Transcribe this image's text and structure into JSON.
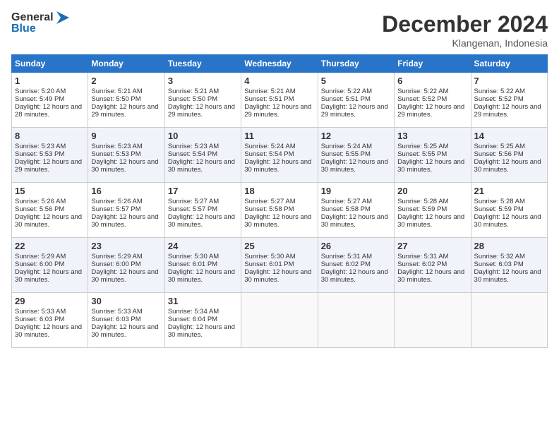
{
  "header": {
    "logo_general": "General",
    "logo_blue": "Blue",
    "month_title": "December 2024",
    "subtitle": "Klangenan, Indonesia"
  },
  "days_of_week": [
    "Sunday",
    "Monday",
    "Tuesday",
    "Wednesday",
    "Thursday",
    "Friday",
    "Saturday"
  ],
  "weeks": [
    [
      {
        "day": "1",
        "sunrise": "Sunrise: 5:20 AM",
        "sunset": "Sunset: 5:49 PM",
        "daylight": "Daylight: 12 hours and 28 minutes."
      },
      {
        "day": "2",
        "sunrise": "Sunrise: 5:21 AM",
        "sunset": "Sunset: 5:50 PM",
        "daylight": "Daylight: 12 hours and 29 minutes."
      },
      {
        "day": "3",
        "sunrise": "Sunrise: 5:21 AM",
        "sunset": "Sunset: 5:50 PM",
        "daylight": "Daylight: 12 hours and 29 minutes."
      },
      {
        "day": "4",
        "sunrise": "Sunrise: 5:21 AM",
        "sunset": "Sunset: 5:51 PM",
        "daylight": "Daylight: 12 hours and 29 minutes."
      },
      {
        "day": "5",
        "sunrise": "Sunrise: 5:22 AM",
        "sunset": "Sunset: 5:51 PM",
        "daylight": "Daylight: 12 hours and 29 minutes."
      },
      {
        "day": "6",
        "sunrise": "Sunrise: 5:22 AM",
        "sunset": "Sunset: 5:52 PM",
        "daylight": "Daylight: 12 hours and 29 minutes."
      },
      {
        "day": "7",
        "sunrise": "Sunrise: 5:22 AM",
        "sunset": "Sunset: 5:52 PM",
        "daylight": "Daylight: 12 hours and 29 minutes."
      }
    ],
    [
      {
        "day": "8",
        "sunrise": "Sunrise: 5:23 AM",
        "sunset": "Sunset: 5:53 PM",
        "daylight": "Daylight: 12 hours and 29 minutes."
      },
      {
        "day": "9",
        "sunrise": "Sunrise: 5:23 AM",
        "sunset": "Sunset: 5:53 PM",
        "daylight": "Daylight: 12 hours and 30 minutes."
      },
      {
        "day": "10",
        "sunrise": "Sunrise: 5:23 AM",
        "sunset": "Sunset: 5:54 PM",
        "daylight": "Daylight: 12 hours and 30 minutes."
      },
      {
        "day": "11",
        "sunrise": "Sunrise: 5:24 AM",
        "sunset": "Sunset: 5:54 PM",
        "daylight": "Daylight: 12 hours and 30 minutes."
      },
      {
        "day": "12",
        "sunrise": "Sunrise: 5:24 AM",
        "sunset": "Sunset: 5:55 PM",
        "daylight": "Daylight: 12 hours and 30 minutes."
      },
      {
        "day": "13",
        "sunrise": "Sunrise: 5:25 AM",
        "sunset": "Sunset: 5:55 PM",
        "daylight": "Daylight: 12 hours and 30 minutes."
      },
      {
        "day": "14",
        "sunrise": "Sunrise: 5:25 AM",
        "sunset": "Sunset: 5:56 PM",
        "daylight": "Daylight: 12 hours and 30 minutes."
      }
    ],
    [
      {
        "day": "15",
        "sunrise": "Sunrise: 5:26 AM",
        "sunset": "Sunset: 5:56 PM",
        "daylight": "Daylight: 12 hours and 30 minutes."
      },
      {
        "day": "16",
        "sunrise": "Sunrise: 5:26 AM",
        "sunset": "Sunset: 5:57 PM",
        "daylight": "Daylight: 12 hours and 30 minutes."
      },
      {
        "day": "17",
        "sunrise": "Sunrise: 5:27 AM",
        "sunset": "Sunset: 5:57 PM",
        "daylight": "Daylight: 12 hours and 30 minutes."
      },
      {
        "day": "18",
        "sunrise": "Sunrise: 5:27 AM",
        "sunset": "Sunset: 5:58 PM",
        "daylight": "Daylight: 12 hours and 30 minutes."
      },
      {
        "day": "19",
        "sunrise": "Sunrise: 5:27 AM",
        "sunset": "Sunset: 5:58 PM",
        "daylight": "Daylight: 12 hours and 30 minutes."
      },
      {
        "day": "20",
        "sunrise": "Sunrise: 5:28 AM",
        "sunset": "Sunset: 5:59 PM",
        "daylight": "Daylight: 12 hours and 30 minutes."
      },
      {
        "day": "21",
        "sunrise": "Sunrise: 5:28 AM",
        "sunset": "Sunset: 5:59 PM",
        "daylight": "Daylight: 12 hours and 30 minutes."
      }
    ],
    [
      {
        "day": "22",
        "sunrise": "Sunrise: 5:29 AM",
        "sunset": "Sunset: 6:00 PM",
        "daylight": "Daylight: 12 hours and 30 minutes."
      },
      {
        "day": "23",
        "sunrise": "Sunrise: 5:29 AM",
        "sunset": "Sunset: 6:00 PM",
        "daylight": "Daylight: 12 hours and 30 minutes."
      },
      {
        "day": "24",
        "sunrise": "Sunrise: 5:30 AM",
        "sunset": "Sunset: 6:01 PM",
        "daylight": "Daylight: 12 hours and 30 minutes."
      },
      {
        "day": "25",
        "sunrise": "Sunrise: 5:30 AM",
        "sunset": "Sunset: 6:01 PM",
        "daylight": "Daylight: 12 hours and 30 minutes."
      },
      {
        "day": "26",
        "sunrise": "Sunrise: 5:31 AM",
        "sunset": "Sunset: 6:02 PM",
        "daylight": "Daylight: 12 hours and 30 minutes."
      },
      {
        "day": "27",
        "sunrise": "Sunrise: 5:31 AM",
        "sunset": "Sunset: 6:02 PM",
        "daylight": "Daylight: 12 hours and 30 minutes."
      },
      {
        "day": "28",
        "sunrise": "Sunrise: 5:32 AM",
        "sunset": "Sunset: 6:03 PM",
        "daylight": "Daylight: 12 hours and 30 minutes."
      }
    ],
    [
      {
        "day": "29",
        "sunrise": "Sunrise: 5:33 AM",
        "sunset": "Sunset: 6:03 PM",
        "daylight": "Daylight: 12 hours and 30 minutes."
      },
      {
        "day": "30",
        "sunrise": "Sunrise: 5:33 AM",
        "sunset": "Sunset: 6:03 PM",
        "daylight": "Daylight: 12 hours and 30 minutes."
      },
      {
        "day": "31",
        "sunrise": "Sunrise: 5:34 AM",
        "sunset": "Sunset: 6:04 PM",
        "daylight": "Daylight: 12 hours and 30 minutes."
      },
      null,
      null,
      null,
      null
    ]
  ]
}
